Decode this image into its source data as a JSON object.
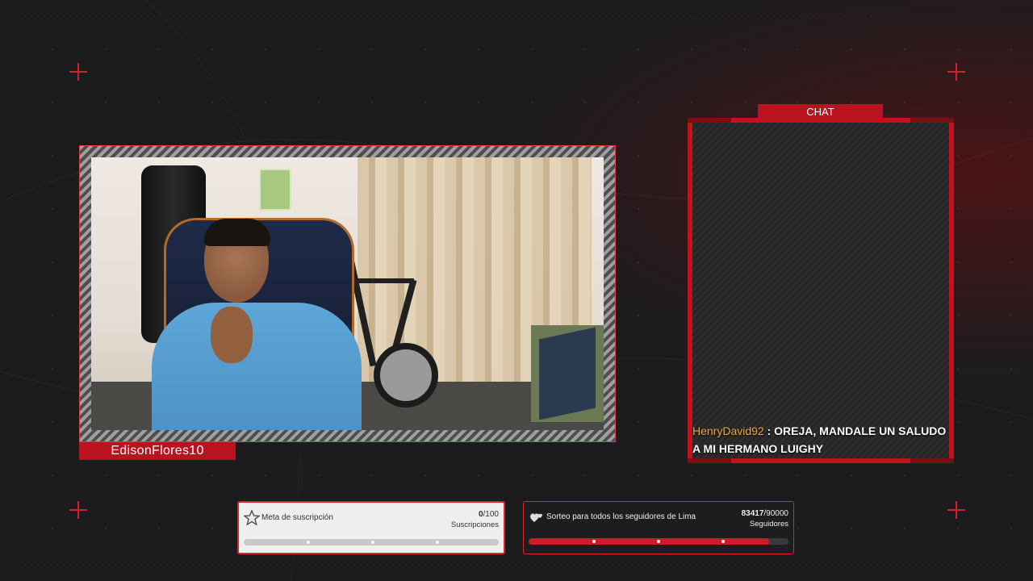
{
  "camera": {
    "streamer_name": "EdisonFlores10"
  },
  "chat": {
    "tab_label": "CHAT",
    "messages": [
      {
        "user": "HenryDavid92",
        "separator": " : ",
        "text": "OREJA, MANDALE UN SALUDO A MI HERMANO LUIGHY"
      }
    ]
  },
  "goals": {
    "subscriptions": {
      "icon": "star-medal-icon",
      "title": "Meta de suscripción",
      "current": "0",
      "target": "/100",
      "unit": "Suscripciones",
      "progress": 0.0
    },
    "followers": {
      "icon": "hearts-icon",
      "title": "Sorteo para todos los seguidores de Lima",
      "current": "83417",
      "target": "/90000",
      "unit": "Seguidores",
      "progress": 0.927
    }
  },
  "colors": {
    "accent_red": "#d11a26",
    "chat_user": "#f2a73b",
    "background": "#1c1c1e"
  }
}
